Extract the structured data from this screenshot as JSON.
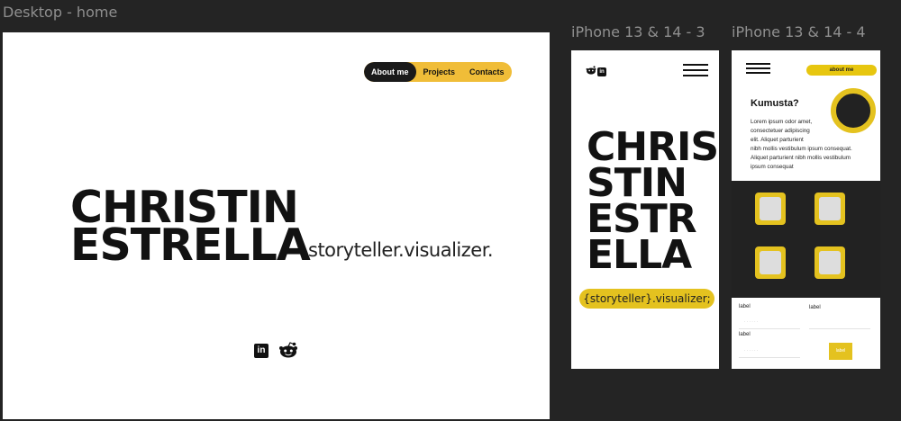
{
  "canvas": {
    "desktop_label": "Desktop - home",
    "phone3_label": "iPhone 13 & 14 - 3",
    "phone4_label": "iPhone 13 & 14 - 4"
  },
  "desktop": {
    "nav": [
      "About me",
      "Projects",
      "Contacts"
    ],
    "name_line1": "CHRISTIN",
    "name_line2": "ESTRELLA",
    "tagline": "storyteller.visualizer.",
    "linkedin_glyph": "in"
  },
  "phone3": {
    "name_lines": [
      "CHRIS",
      "STIN",
      "ESTR",
      "ELLA"
    ],
    "tagline": "{storyteller}.visualizer;",
    "linkedin_glyph": "in"
  },
  "phone4": {
    "about_label": "about me",
    "heading": "Kumusta?",
    "lorem_lines": [
      "Lorem ipsum odor amet,",
      "consectetuer adipiscing",
      " elit. Aliquet parturient",
      "nibh mollis vestibulum ipsum consequat.",
      "Aliquet parturient nibh mollis vestibulum",
      "ipsum consequat"
    ],
    "form": {
      "label1": "label",
      "label2": "label",
      "label3": "label",
      "placeholder1": ". . . . . .",
      "placeholder2": ". . . . . .",
      "button": "label"
    }
  },
  "colors": {
    "accent": "#f0bd38",
    "accent2": "#e4c21f",
    "dark": "#222222",
    "canvas": "#242424"
  }
}
